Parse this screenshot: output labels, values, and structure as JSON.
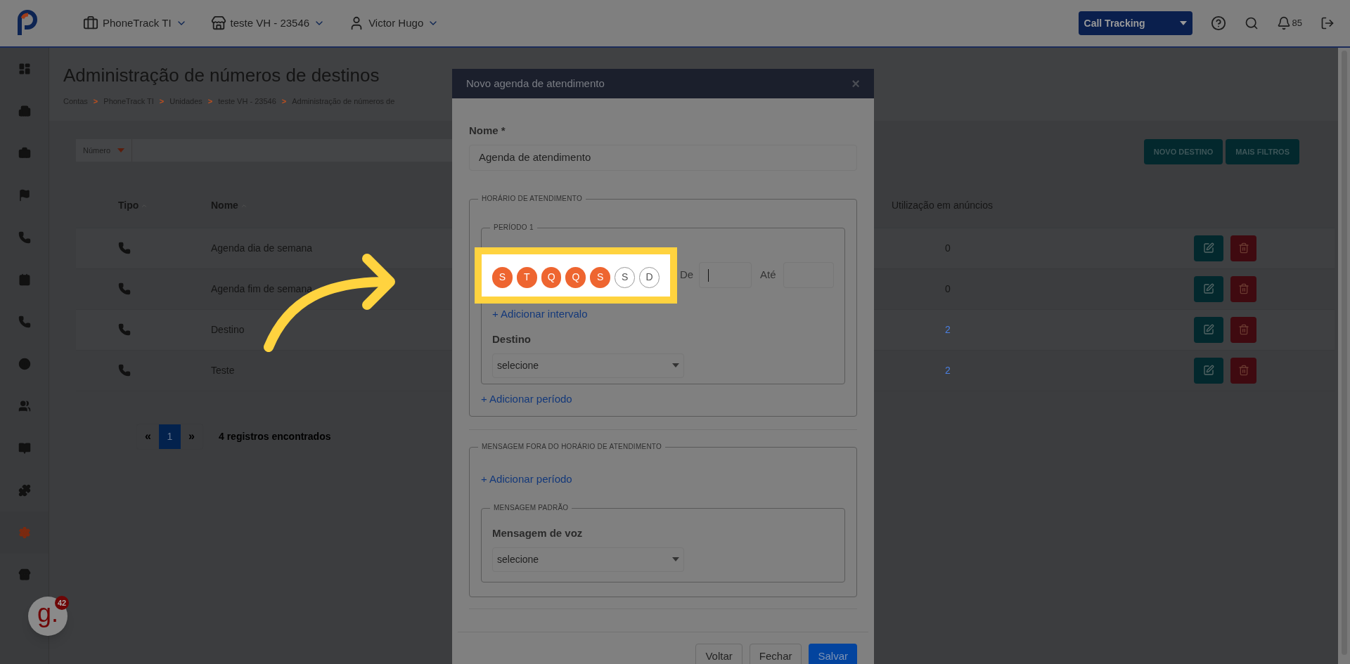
{
  "topbar": {
    "nav": [
      {
        "kind": "account",
        "label": "PhoneTrack TI"
      },
      {
        "kind": "unit",
        "label": "teste VH - 23546"
      },
      {
        "kind": "user",
        "label": "Victor Hugo"
      }
    ],
    "product": "Call Tracking",
    "notifications": "85"
  },
  "sidebar": {
    "items": [
      {
        "kind": "dashboard",
        "selected": false
      },
      {
        "kind": "building",
        "selected": false
      },
      {
        "kind": "briefcase",
        "selected": false
      },
      {
        "kind": "flag",
        "selected": false
      },
      {
        "kind": "phone",
        "selected": false
      },
      {
        "kind": "contact",
        "selected": false
      },
      {
        "kind": "phone",
        "selected": false
      },
      {
        "kind": "disc",
        "selected": false
      },
      {
        "kind": "users",
        "selected": false
      },
      {
        "kind": "book",
        "selected": false
      },
      {
        "kind": "puzzle",
        "selected": false
      },
      {
        "kind": "settings",
        "selected": true
      },
      {
        "kind": "store",
        "selected": false
      }
    ]
  },
  "page": {
    "title": "Administração de números de destinos",
    "breadcrumb_separator": ">",
    "breadcrumb": [
      "Contas",
      "PhoneTrack TI",
      "Unidades",
      "teste VH - 23546",
      "Administração de números de"
    ],
    "filter": "Número",
    "buttons": [
      "NOVO DESTINO",
      "MAIS FILTROS"
    ],
    "table": {
      "columns": [
        "Tipo",
        "Nome",
        "Utilização em anúncios"
      ],
      "rows": [
        {
          "name": "Agenda dia de semana",
          "usage": "0",
          "linked": false
        },
        {
          "name": "Agenda fim de semana",
          "usage": "0",
          "linked": false
        },
        {
          "name": "Destino",
          "usage": "2",
          "linked": true
        },
        {
          "name": "Teste",
          "usage": "2",
          "linked": true
        }
      ]
    },
    "pagination": {
      "prev": "«",
      "pages": [
        {
          "label": "1",
          "selected": true
        }
      ],
      "next": "»",
      "summary": "4 registros encontrados"
    }
  },
  "modal": {
    "title": "Novo agenda de atendimento",
    "close": "×",
    "name_label": "Nome *",
    "name_value": "Agenda de atendimento",
    "schedule_legend": "HORÁRIO DE ATENDIMENTO",
    "period_legend": "PERÍODO 1",
    "days": [
      {
        "label": "S",
        "selected": true
      },
      {
        "label": "T",
        "selected": true
      },
      {
        "label": "Q",
        "selected": true
      },
      {
        "label": "Q",
        "selected": true
      },
      {
        "label": "S",
        "selected": true
      },
      {
        "label": "S",
        "selected": false
      },
      {
        "label": "D",
        "selected": false
      }
    ],
    "from_label": "De",
    "to_label": "Até",
    "add_interval": "+ Adicionar intervalo",
    "destination_label": "Destino",
    "destination_select": "selecione",
    "add_period": "+ Adicionar período",
    "message_legend": "MENSAGEM FORA DO HORÁRIO DE ATENDIMENTO",
    "message_add_period": "+ Adicionar período",
    "default_legend": "MENSAGEM PADRÃO",
    "voice_label": "Mensagem de voz",
    "voice_select": "selecione",
    "buttons": [
      {
        "kind": "secondary",
        "label": "Voltar"
      },
      {
        "kind": "secondary",
        "label": "Fechar"
      },
      {
        "kind": "primary",
        "label": "Salvar"
      }
    ]
  },
  "widget": {
    "logo": "g.",
    "badge": "42"
  }
}
